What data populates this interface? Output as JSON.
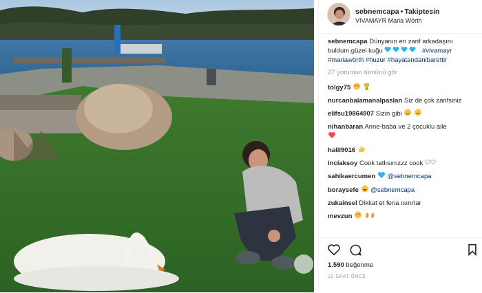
{
  "post": {
    "username": "sebnemcapa",
    "follow_status": "Takiptesin",
    "location": "VIVAMAYR Maria Wörth",
    "caption_user": "sebnemcapa",
    "caption_text": "Dünyanın en zarif arkadaşını buldum,güzel kuğu",
    "caption_tags": [
      "#vivamayr",
      "#mariawörth",
      "#huzur",
      "#hayatandanibarettir"
    ],
    "view_all": "27 yorumun tümünü gör",
    "likes_count": "1.590",
    "likes_label": "beğenme",
    "time_ago": "12 SAAT ÖNCE"
  },
  "comments": [
    {
      "user": "tolgy75",
      "text": ""
    },
    {
      "user": "nurcanbalamanalpaslan",
      "text": "Siz de çok zarifsiniz"
    },
    {
      "user": "elifsu19864907",
      "text": "Sizin gibi"
    },
    {
      "user": "nihanbaran",
      "text": "Anne-baba ve 2 çocuklu aile"
    },
    {
      "user": "halil9016",
      "text": ""
    },
    {
      "user": "inciaksoy",
      "text": "Cook tatlısınızzz cook"
    },
    {
      "user": "sahikaercumen",
      "text": "@sebnemcapa"
    },
    {
      "user": "boraysefe",
      "text": "@sebnemcapa"
    },
    {
      "user": "zukainsel",
      "text": "Dikkat et fena ısırırlar"
    },
    {
      "user": "mevzun",
      "text": ""
    }
  ],
  "icons": {
    "like": "heart-outline-icon",
    "comment": "comment-bubble-icon",
    "save": "bookmark-icon"
  },
  "colors": {
    "hashtag": "#003569",
    "text": "#262626",
    "muted": "#999999",
    "divider": "#efefef",
    "emoji_heart_blue": "#31b5e8",
    "emoji_heart_red": "#ed4956"
  }
}
